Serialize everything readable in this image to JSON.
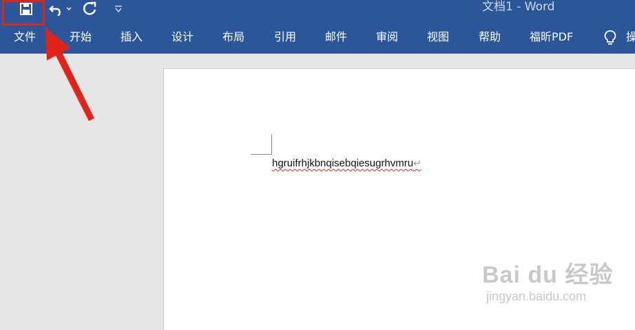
{
  "window": {
    "title": "文档1  -  Word"
  },
  "qat": {
    "save_icon": "save-icon",
    "undo_icon": "undo-icon",
    "redo_icon": "redo-icon",
    "customize_icon": "customize-qat-icon"
  },
  "ribbon": {
    "tabs": [
      {
        "label": "文件"
      },
      {
        "label": "开始"
      },
      {
        "label": "插入"
      },
      {
        "label": "设计"
      },
      {
        "label": "布局"
      },
      {
        "label": "引用"
      },
      {
        "label": "邮件"
      },
      {
        "label": "审阅"
      },
      {
        "label": "视图"
      },
      {
        "label": "帮助"
      },
      {
        "label": "福昕PDF"
      }
    ],
    "tell_me_partial": "操",
    "tell_me_icon": "lightbulb-icon"
  },
  "document": {
    "text": "hgruifrhjkbnqisebqiesugrhvmru",
    "paragraph_mark": "↵"
  },
  "annotation": {
    "color": "#e2231a",
    "highlight_target": "save-button"
  },
  "watermark": {
    "brand": "Bai du 经验",
    "url": "jingyan.baidu.com"
  },
  "colors": {
    "ribbon_blue": "#2b579a",
    "canvas_gray": "#e6e6e6",
    "spell_error_red": "#e02020"
  }
}
